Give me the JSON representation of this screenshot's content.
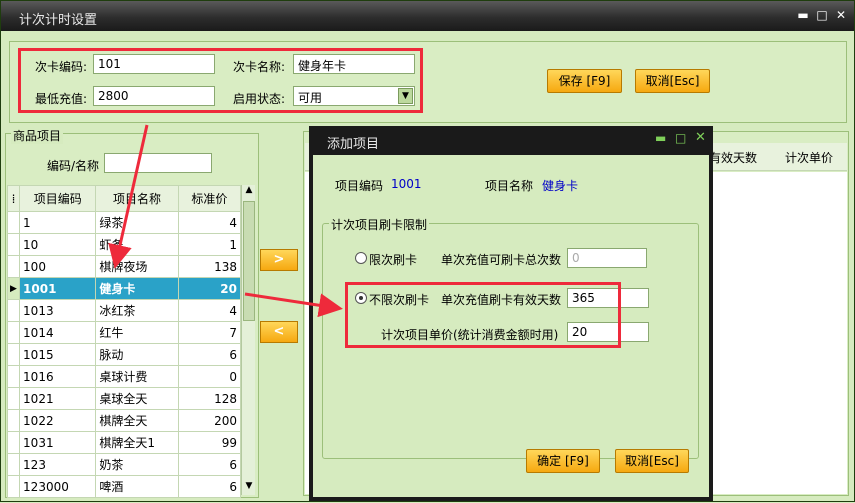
{
  "window": {
    "title": "计次计时设置",
    "min": "▬",
    "max": "□",
    "close": "✕"
  },
  "form": {
    "code_label": "次卡编码:",
    "code_value": "101",
    "name_label": "次卡名称:",
    "name_value": "健身年卡",
    "min_label": "最低充值:",
    "min_value": "2800",
    "status_label": "启用状态:",
    "status_value": "可用"
  },
  "buttons": {
    "save": "保存 [F9]",
    "cancel": "取消[Esc]"
  },
  "products": {
    "group_title": "商品项目",
    "filter_label": "编码/名称",
    "headers": [
      "项目编码",
      "项目名称",
      "标准价"
    ],
    "rows": [
      {
        "code": "1",
        "name": "绿茶",
        "price": "4"
      },
      {
        "code": "10",
        "name": "虾条",
        "price": "1"
      },
      {
        "code": "100",
        "name": "棋牌夜场",
        "price": "138"
      },
      {
        "code": "1001",
        "name": "健身卡",
        "price": "20"
      },
      {
        "code": "1013",
        "name": "冰红茶",
        "price": "4"
      },
      {
        "code": "1014",
        "name": "红牛",
        "price": "7"
      },
      {
        "code": "1015",
        "name": "脉动",
        "price": "6"
      },
      {
        "code": "1016",
        "name": "桌球计费",
        "price": "0"
      },
      {
        "code": "1021",
        "name": "桌球全天",
        "price": "128"
      },
      {
        "code": "1022",
        "name": "棋牌全天",
        "price": "200"
      },
      {
        "code": "1031",
        "name": "棋牌全天1",
        "price": "99"
      },
      {
        "code": "123",
        "name": "奶茶",
        "price": "6"
      },
      {
        "code": "123000",
        "name": "啤酒",
        "price": "6"
      }
    ]
  },
  "move": {
    "right": ">",
    "left": "<"
  },
  "right_headers": [
    "有效天数",
    "计次单价"
  ],
  "dialog": {
    "title": "添加项目",
    "item_code_label": "项目编码",
    "item_code": "1001",
    "item_name_label": "项目名称",
    "item_name": "健身卡",
    "group_title": "计次项目刷卡限制",
    "limited_label": "限次刷卡",
    "limited_desc": "单次充值可刷卡总次数",
    "limited_value": "0",
    "unlimited_label": "不限次刷卡",
    "unlimited_desc": "单次充值刷卡有效天数",
    "unlimited_value": "365",
    "price_label": "计次项目单价(统计消费金额时用)",
    "price_value": "20",
    "ok": "确定 [F9]",
    "cancel": "取消[Esc]"
  },
  "colors": {
    "accent": "#f6a810",
    "selection": "#2aa2c8",
    "highlight": "#ee2a3b"
  }
}
